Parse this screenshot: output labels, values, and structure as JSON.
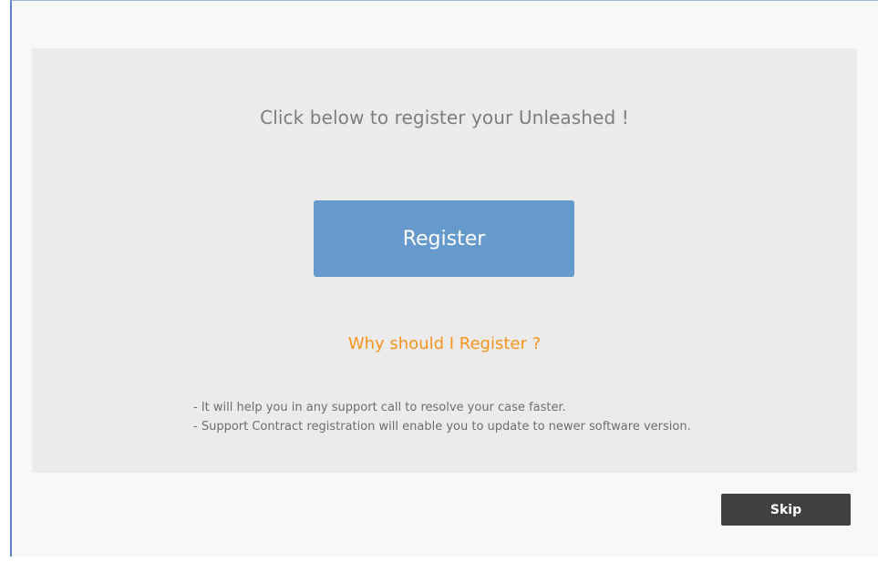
{
  "registration": {
    "heading": "Click below to register your Unleashed !",
    "register_label": "Register",
    "why_label": "Why should I Register ?",
    "reasons": [
      "- It will help you in any support call to resolve your case faster.",
      "- Support Contract registration will enable you to update to newer software version."
    ]
  },
  "footer": {
    "skip_label": "Skip"
  },
  "colors": {
    "register_button": "#6699cc",
    "why_link": "#f7941d",
    "skip_button": "#404040",
    "panel_background": "#ebebeb"
  }
}
